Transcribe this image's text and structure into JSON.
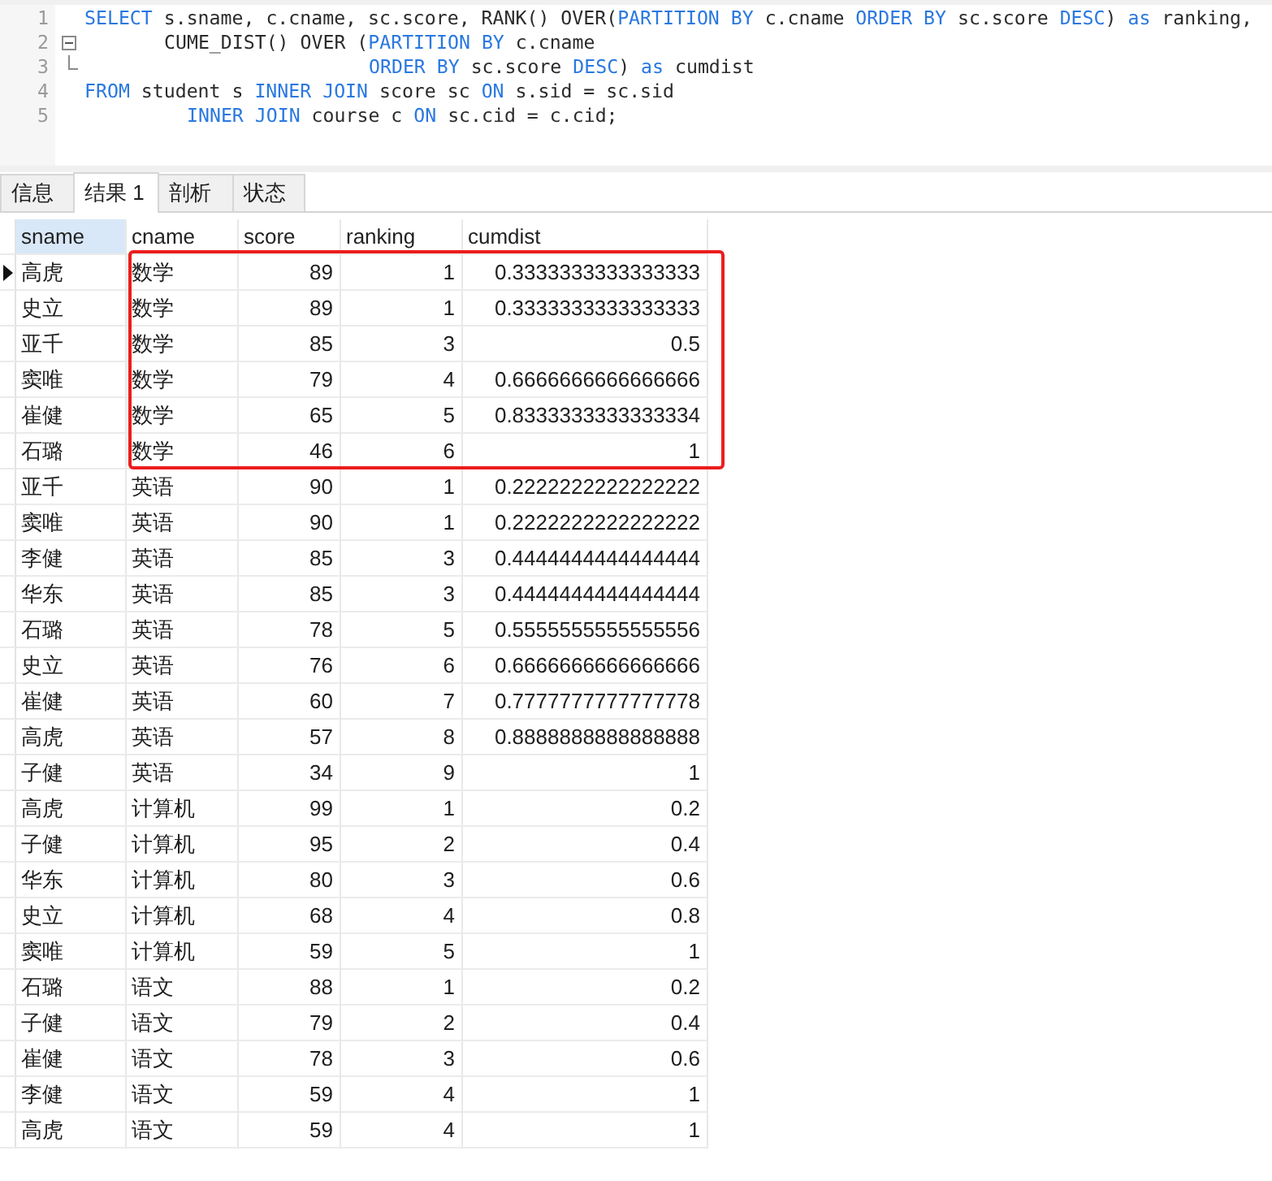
{
  "editor": {
    "lines": [
      {
        "number": "1",
        "kind": "plain",
        "tokens": [
          {
            "kind": "keyword",
            "text": "SELECT"
          },
          {
            "kind": "plain",
            "text": " s.sname, c.cname, sc.score, RANK() OVER("
          },
          {
            "kind": "keyword",
            "text": "PARTITION BY"
          },
          {
            "kind": "plain",
            "text": " c.cname "
          },
          {
            "kind": "keyword",
            "text": "ORDER BY"
          },
          {
            "kind": "plain",
            "text": " sc.score "
          },
          {
            "kind": "keyword",
            "text": "DESC"
          },
          {
            "kind": "plain",
            "text": ") "
          },
          {
            "kind": "keyword",
            "text": "as"
          },
          {
            "kind": "plain",
            "text": " ranking,"
          }
        ]
      },
      {
        "number": "2",
        "kind": "foldstart",
        "tokens": [
          {
            "kind": "plain",
            "text": "       CUME_DIST() OVER ("
          },
          {
            "kind": "keyword",
            "text": "PARTITION BY"
          },
          {
            "kind": "plain",
            "text": " c.cname"
          }
        ]
      },
      {
        "number": "3",
        "kind": "foldend",
        "tokens": [
          {
            "kind": "keyword",
            "text": "                         ORDER BY"
          },
          {
            "kind": "plain",
            "text": " sc.score "
          },
          {
            "kind": "keyword",
            "text": "DESC"
          },
          {
            "kind": "plain",
            "text": ") "
          },
          {
            "kind": "keyword",
            "text": "as"
          },
          {
            "kind": "plain",
            "text": " cumdist"
          }
        ]
      },
      {
        "number": "4",
        "kind": "plain",
        "tokens": [
          {
            "kind": "keyword",
            "text": "FROM"
          },
          {
            "kind": "plain",
            "text": " student s "
          },
          {
            "kind": "keyword",
            "text": "INNER JOIN"
          },
          {
            "kind": "plain",
            "text": " score sc "
          },
          {
            "kind": "keyword",
            "text": "ON"
          },
          {
            "kind": "plain",
            "text": " s.sid = sc.sid"
          }
        ]
      },
      {
        "number": "5",
        "kind": "plain",
        "tokens": [
          {
            "kind": "keyword",
            "text": "         INNER JOIN"
          },
          {
            "kind": "plain",
            "text": " course c "
          },
          {
            "kind": "keyword",
            "text": "ON"
          },
          {
            "kind": "plain",
            "text": " sc.cid = c.cid;"
          }
        ]
      }
    ]
  },
  "tabs": [
    {
      "label": "信息",
      "selected": false
    },
    {
      "label": "结果 1",
      "selected": true
    },
    {
      "label": "剖析",
      "selected": false
    },
    {
      "label": "状态",
      "selected": false
    }
  ],
  "table": {
    "columns": [
      {
        "label": "sname",
        "kind": "text",
        "selected": true
      },
      {
        "label": "cname",
        "kind": "text",
        "selected": false
      },
      {
        "label": "score",
        "kind": "number",
        "selected": false
      },
      {
        "label": "ranking",
        "kind": "number",
        "selected": false
      },
      {
        "label": "cumdist",
        "kind": "number",
        "selected": false
      }
    ],
    "row_groups": [
      {
        "framed": true,
        "rows": [
          {
            "selected": true,
            "cells": [
              "高虎",
              "数学",
              "89",
              "1",
              "0.3333333333333333"
            ]
          },
          {
            "selected": false,
            "cells": [
              "史立",
              "数学",
              "89",
              "1",
              "0.3333333333333333"
            ]
          },
          {
            "selected": false,
            "cells": [
              "亚千",
              "数学",
              "85",
              "3",
              "0.5"
            ]
          },
          {
            "selected": false,
            "cells": [
              "窦唯",
              "数学",
              "79",
              "4",
              "0.6666666666666666"
            ]
          },
          {
            "selected": false,
            "cells": [
              "崔健",
              "数学",
              "65",
              "5",
              "0.8333333333333334"
            ]
          },
          {
            "selected": false,
            "cells": [
              "石璐",
              "数学",
              "46",
              "6",
              "1"
            ]
          }
        ]
      },
      {
        "framed": false,
        "rows": [
          {
            "selected": false,
            "cells": [
              "亚千",
              "英语",
              "90",
              "1",
              "0.2222222222222222"
            ]
          },
          {
            "selected": false,
            "cells": [
              "窦唯",
              "英语",
              "90",
              "1",
              "0.2222222222222222"
            ]
          },
          {
            "selected": false,
            "cells": [
              "李健",
              "英语",
              "85",
              "3",
              "0.4444444444444444"
            ]
          },
          {
            "selected": false,
            "cells": [
              "华东",
              "英语",
              "85",
              "3",
              "0.4444444444444444"
            ]
          },
          {
            "selected": false,
            "cells": [
              "石璐",
              "英语",
              "78",
              "5",
              "0.5555555555555556"
            ]
          },
          {
            "selected": false,
            "cells": [
              "史立",
              "英语",
              "76",
              "6",
              "0.6666666666666666"
            ]
          },
          {
            "selected": false,
            "cells": [
              "崔健",
              "英语",
              "60",
              "7",
              "0.7777777777777778"
            ]
          },
          {
            "selected": false,
            "cells": [
              "高虎",
              "英语",
              "57",
              "8",
              "0.8888888888888888"
            ]
          },
          {
            "selected": false,
            "cells": [
              "子健",
              "英语",
              "34",
              "9",
              "1"
            ]
          },
          {
            "selected": false,
            "cells": [
              "高虎",
              "计算机",
              "99",
              "1",
              "0.2"
            ]
          },
          {
            "selected": false,
            "cells": [
              "子健",
              "计算机",
              "95",
              "2",
              "0.4"
            ]
          },
          {
            "selected": false,
            "cells": [
              "华东",
              "计算机",
              "80",
              "3",
              "0.6"
            ]
          },
          {
            "selected": false,
            "cells": [
              "史立",
              "计算机",
              "68",
              "4",
              "0.8"
            ]
          },
          {
            "selected": false,
            "cells": [
              "窦唯",
              "计算机",
              "59",
              "5",
              "1"
            ]
          },
          {
            "selected": false,
            "cells": [
              "石璐",
              "语文",
              "88",
              "1",
              "0.2"
            ]
          },
          {
            "selected": false,
            "cells": [
              "子健",
              "语文",
              "79",
              "2",
              "0.4"
            ]
          },
          {
            "selected": false,
            "cells": [
              "崔健",
              "语文",
              "78",
              "3",
              "0.6"
            ]
          },
          {
            "selected": false,
            "cells": [
              "李健",
              "语文",
              "59",
              "4",
              "1"
            ]
          },
          {
            "selected": false,
            "cells": [
              "高虎",
              "语文",
              "59",
              "4",
              "1"
            ]
          }
        ]
      }
    ]
  }
}
